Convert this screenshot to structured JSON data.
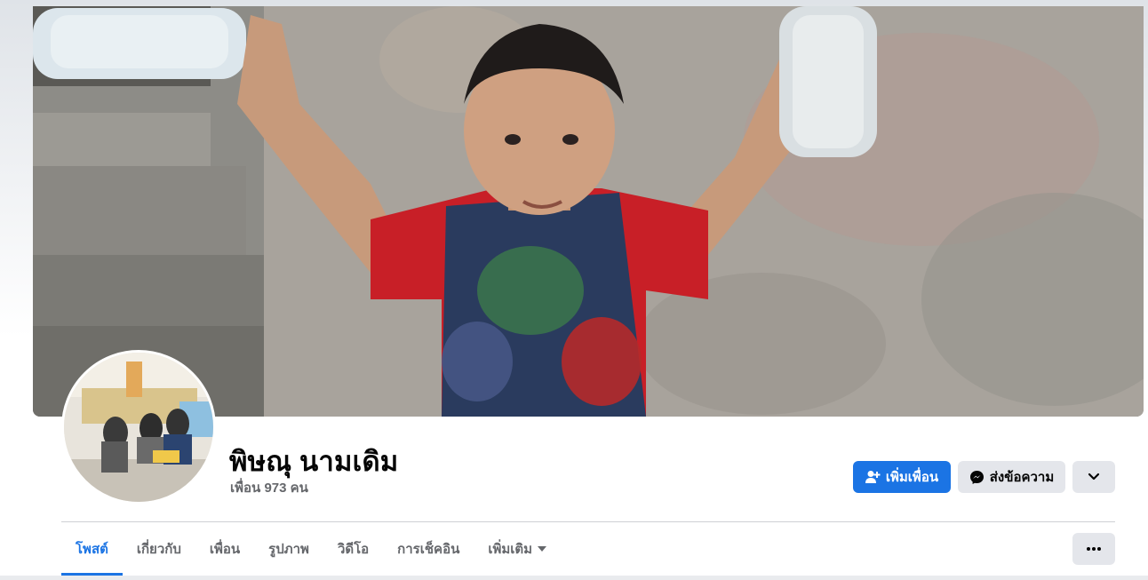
{
  "profile": {
    "name": "พิษณุ นามเดิม",
    "friends_count": "เพื่อน 973 คน"
  },
  "actions": {
    "add_friend_label": "เพิ่มเพื่อน",
    "message_label": "ส่งข้อความ"
  },
  "tabs": [
    {
      "label": "โพสต์",
      "active": true
    },
    {
      "label": "เกี่ยวกับ",
      "active": false
    },
    {
      "label": "เพื่อน",
      "active": false
    },
    {
      "label": "รูปภาพ",
      "active": false
    },
    {
      "label": "วิดีโอ",
      "active": false
    },
    {
      "label": "การเช็คอิน",
      "active": false
    },
    {
      "label": "เพิ่มเติม",
      "active": false
    }
  ],
  "icons": {
    "add_friend": "person-add-icon",
    "message": "messenger-icon",
    "more": "chevron-down-icon",
    "tab_more": "caret-down-icon",
    "overflow": "ellipsis-icon"
  },
  "colors": {
    "accent": "#1b74e4",
    "secondary_button": "#e4e6eb",
    "text_primary": "#050505",
    "text_secondary": "#65676b"
  }
}
